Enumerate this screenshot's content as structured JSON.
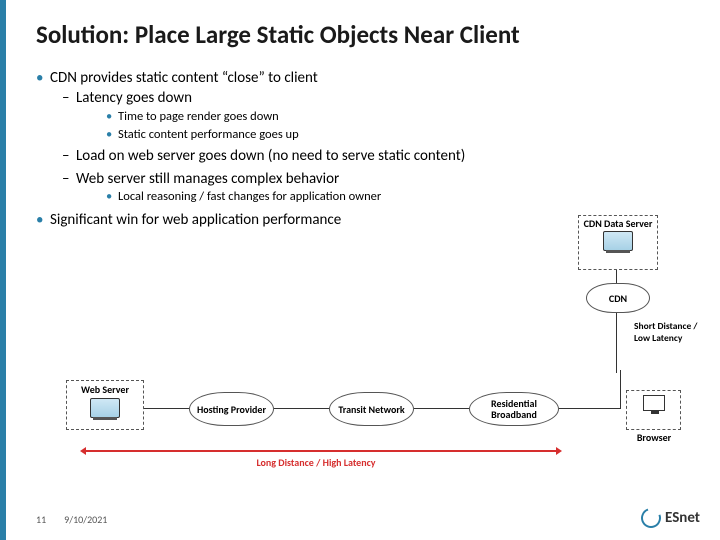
{
  "title": "Solution: Place Large Static Objects Near Client",
  "bullets": {
    "b1": "CDN provides static content “close” to client",
    "b1a": "Latency goes down",
    "b1a1": "Time to page render goes down",
    "b1a2": "Static content performance goes up",
    "b1b": "Load on web server goes down (no need to serve static content)",
    "b1c": "Web server still manages complex behavior",
    "b1c1": "Local reasoning / fast changes for application owner",
    "b2": "Significant win for web application performance"
  },
  "diagram": {
    "web_server": "Web Server",
    "hosting": "Hosting Provider",
    "transit": "Transit Network",
    "residential": "Residential Broadband",
    "browser": "Browser",
    "cdn_data": "CDN Data Server",
    "cdn": "CDN",
    "long": "Long Distance / High Latency",
    "short": "Short Distance / Low Latency"
  },
  "footer": {
    "page": "11",
    "date": "9/10/2021"
  },
  "logo": "ESnet"
}
